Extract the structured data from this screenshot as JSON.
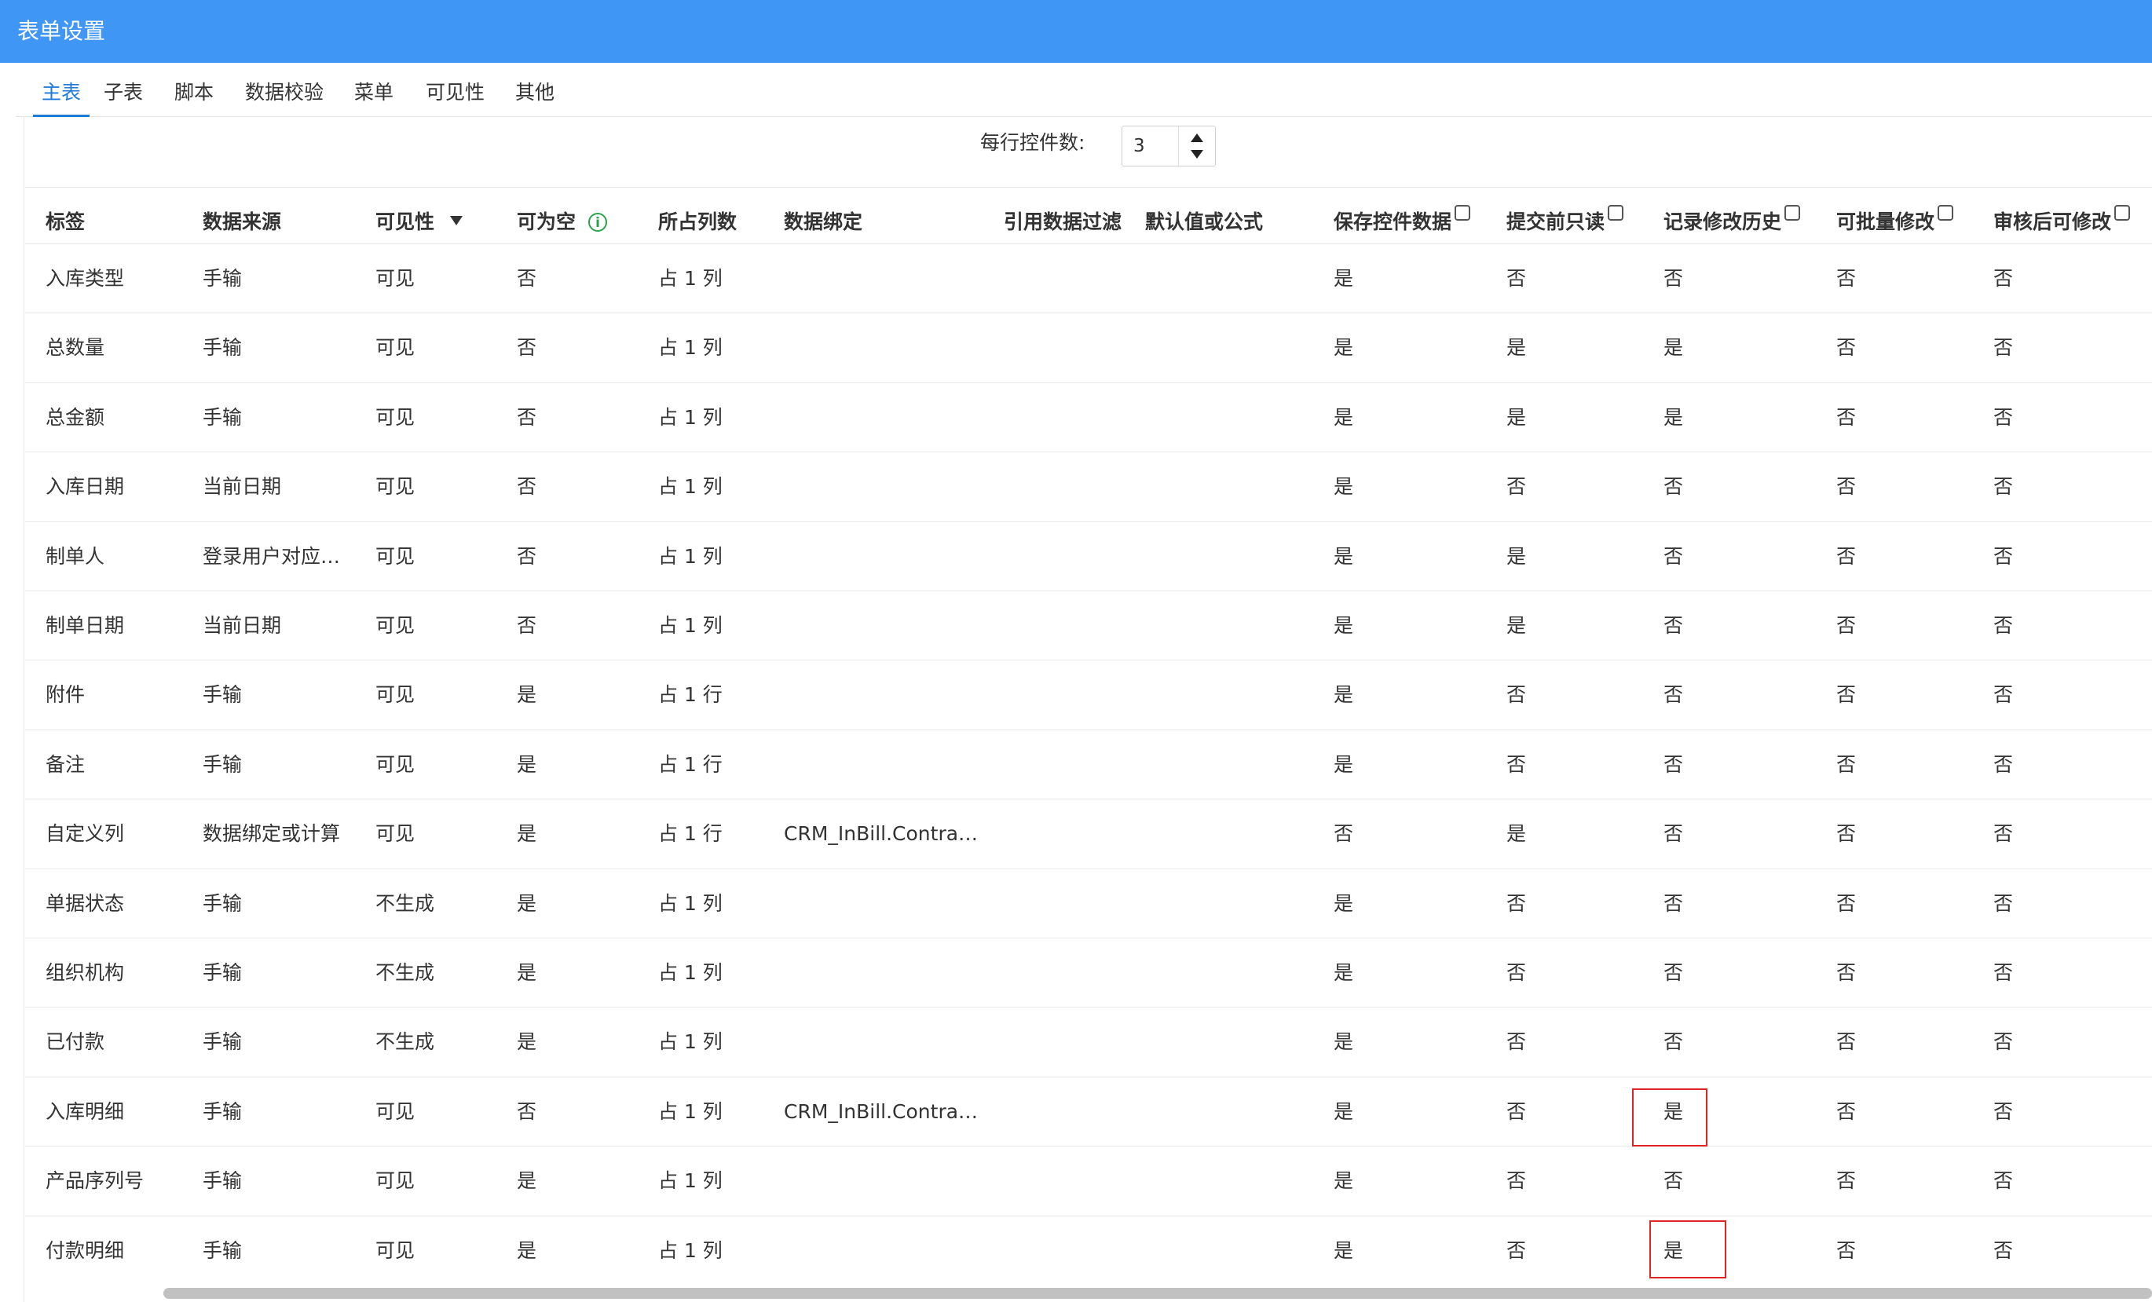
{
  "window": {
    "title": "表单设置"
  },
  "tabs": [
    {
      "label": "主表",
      "active": true
    },
    {
      "label": "子表"
    },
    {
      "label": "脚本"
    },
    {
      "label": "数据校验"
    },
    {
      "label": "菜单"
    },
    {
      "label": "可见性"
    },
    {
      "label": "其他"
    }
  ],
  "per_row": {
    "label": "每行控件数:",
    "value": "3"
  },
  "columns": [
    "标签",
    "数据来源",
    "可见性",
    "可为空",
    "所占列数",
    "数据绑定",
    "引用数据过滤",
    "默认值或公式",
    "保存控件数据",
    "提交前只读",
    "记录修改历史",
    "可批量修改",
    "审核后可修改"
  ],
  "rows": [
    [
      "入库类型",
      "手输",
      "可见",
      "否",
      "占 1 列",
      "",
      "",
      "",
      "是",
      "否",
      "否",
      "否",
      "否"
    ],
    [
      "总数量",
      "手输",
      "可见",
      "否",
      "占 1 列",
      "",
      "",
      "",
      "是",
      "是",
      "是",
      "否",
      "否"
    ],
    [
      "总金额",
      "手输",
      "可见",
      "否",
      "占 1 列",
      "",
      "",
      "",
      "是",
      "是",
      "是",
      "否",
      "否"
    ],
    [
      "入库日期",
      "当前日期",
      "可见",
      "否",
      "占 1 列",
      "",
      "",
      "",
      "是",
      "否",
      "否",
      "否",
      "否"
    ],
    [
      "制单人",
      "登录用户对应…",
      "可见",
      "否",
      "占 1 列",
      "",
      "",
      "",
      "是",
      "是",
      "否",
      "否",
      "否"
    ],
    [
      "制单日期",
      "当前日期",
      "可见",
      "否",
      "占 1 列",
      "",
      "",
      "",
      "是",
      "是",
      "否",
      "否",
      "否"
    ],
    [
      "附件",
      "手输",
      "可见",
      "是",
      "占 1 行",
      "",
      "",
      "",
      "是",
      "否",
      "否",
      "否",
      "否"
    ],
    [
      "备注",
      "手输",
      "可见",
      "是",
      "占 1 行",
      "",
      "",
      "",
      "是",
      "否",
      "否",
      "否",
      "否"
    ],
    [
      "自定义列",
      "数据绑定或计算",
      "可见",
      "是",
      "占 1 行",
      "CRM_InBill.ContractI…",
      "",
      "",
      "否",
      "是",
      "否",
      "否",
      "否"
    ],
    [
      "单据状态",
      "手输",
      "不生成",
      "是",
      "占 1 列",
      "",
      "",
      "",
      "是",
      "否",
      "否",
      "否",
      "否"
    ],
    [
      "组织机构",
      "手输",
      "不生成",
      "是",
      "占 1 列",
      "",
      "",
      "",
      "是",
      "否",
      "否",
      "否",
      "否"
    ],
    [
      "已付款",
      "手输",
      "不生成",
      "是",
      "占 1 列",
      "",
      "",
      "",
      "是",
      "否",
      "否",
      "否",
      "否"
    ],
    [
      "入库明细",
      "手输",
      "可见",
      "否",
      "占 1 列",
      "CRM_InBill.ContractI…",
      "",
      "",
      "是",
      "否",
      "是",
      "否",
      "否"
    ],
    [
      "产品序列号",
      "手输",
      "可见",
      "是",
      "占 1 列",
      "",
      "",
      "",
      "是",
      "否",
      "否",
      "否",
      "否"
    ],
    [
      "付款明细",
      "手输",
      "可见",
      "是",
      "占 1 列",
      "",
      "",
      "",
      "是",
      "否",
      "是",
      "否",
      "否"
    ]
  ],
  "colors": {
    "titlebar": "#4096f5",
    "tab_active": "#1e7ad6",
    "highlight": "#e02424",
    "info": "#2ca24a"
  }
}
